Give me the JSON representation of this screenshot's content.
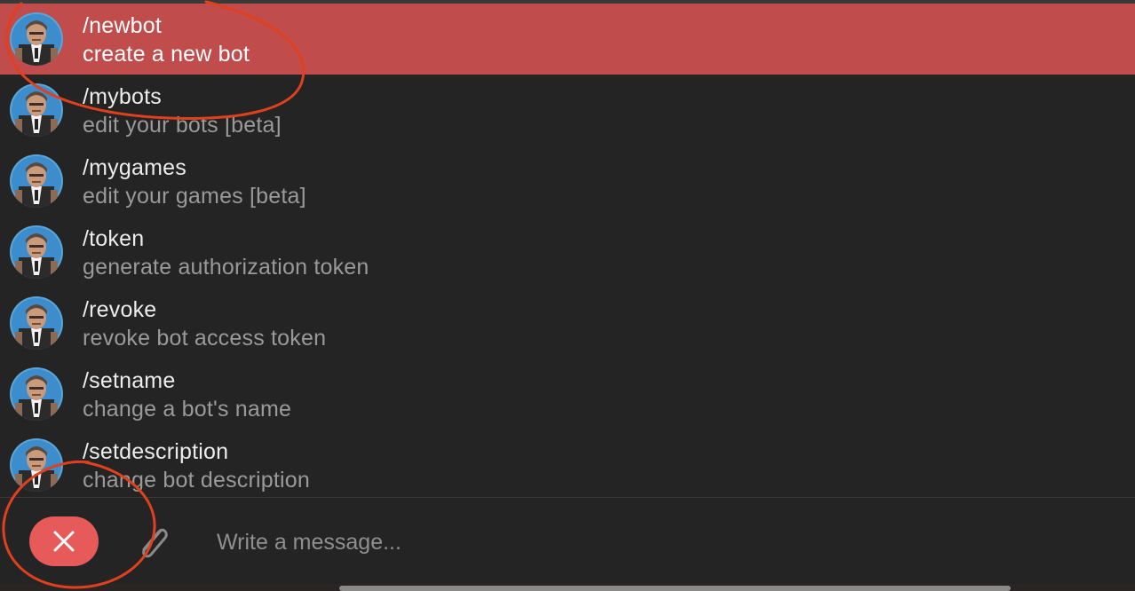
{
  "commands": [
    {
      "name": "/newbot",
      "description": "create a new bot",
      "selected": true
    },
    {
      "name": "/mybots",
      "description": "edit your bots [beta]",
      "selected": false
    },
    {
      "name": "/mygames",
      "description": "edit your games [beta]",
      "selected": false
    },
    {
      "name": "/token",
      "description": "generate authorization token",
      "selected": false
    },
    {
      "name": "/revoke",
      "description": "revoke bot access token",
      "selected": false
    },
    {
      "name": "/setname",
      "description": "change a bot's name",
      "selected": false
    },
    {
      "name": "/setdescription",
      "description": "change bot description",
      "selected": false
    }
  ],
  "composer": {
    "message_placeholder": "Write a message...",
    "message_value": "",
    "close_icon": "close-icon",
    "attach_icon": "paperclip-icon"
  },
  "colors": {
    "background": "#242424",
    "selected_row": "#c04c4c",
    "close_button": "#e65a5a",
    "annotation": "#e0401e"
  }
}
